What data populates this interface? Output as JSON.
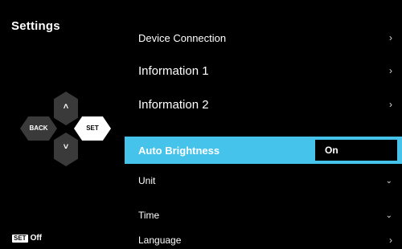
{
  "header": {
    "title": "Settings"
  },
  "dpad": {
    "up_icon": "chevron-up-icon",
    "down_icon": "chevron-down-icon",
    "back_label": "BACK",
    "set_label": "SET",
    "up_glyph": "˄",
    "down_glyph": "˅"
  },
  "footer": {
    "badge": "SET",
    "text": "Off"
  },
  "menu": {
    "items": [
      {
        "label": "Device Connection",
        "arrow": "›"
      },
      {
        "label": "Information 1",
        "arrow": "›"
      },
      {
        "label": "Information 2",
        "arrow": "›"
      },
      {
        "label": "Auto Brightness",
        "value": "On",
        "selected": true
      },
      {
        "label": "Unit",
        "arrow": "⌄"
      },
      {
        "label": "Time",
        "arrow": "⌄"
      },
      {
        "label": "Language",
        "arrow": "›"
      }
    ]
  },
  "colors": {
    "highlight": "#46c3ea",
    "background": "#000000",
    "button": "#3a3a3a"
  }
}
